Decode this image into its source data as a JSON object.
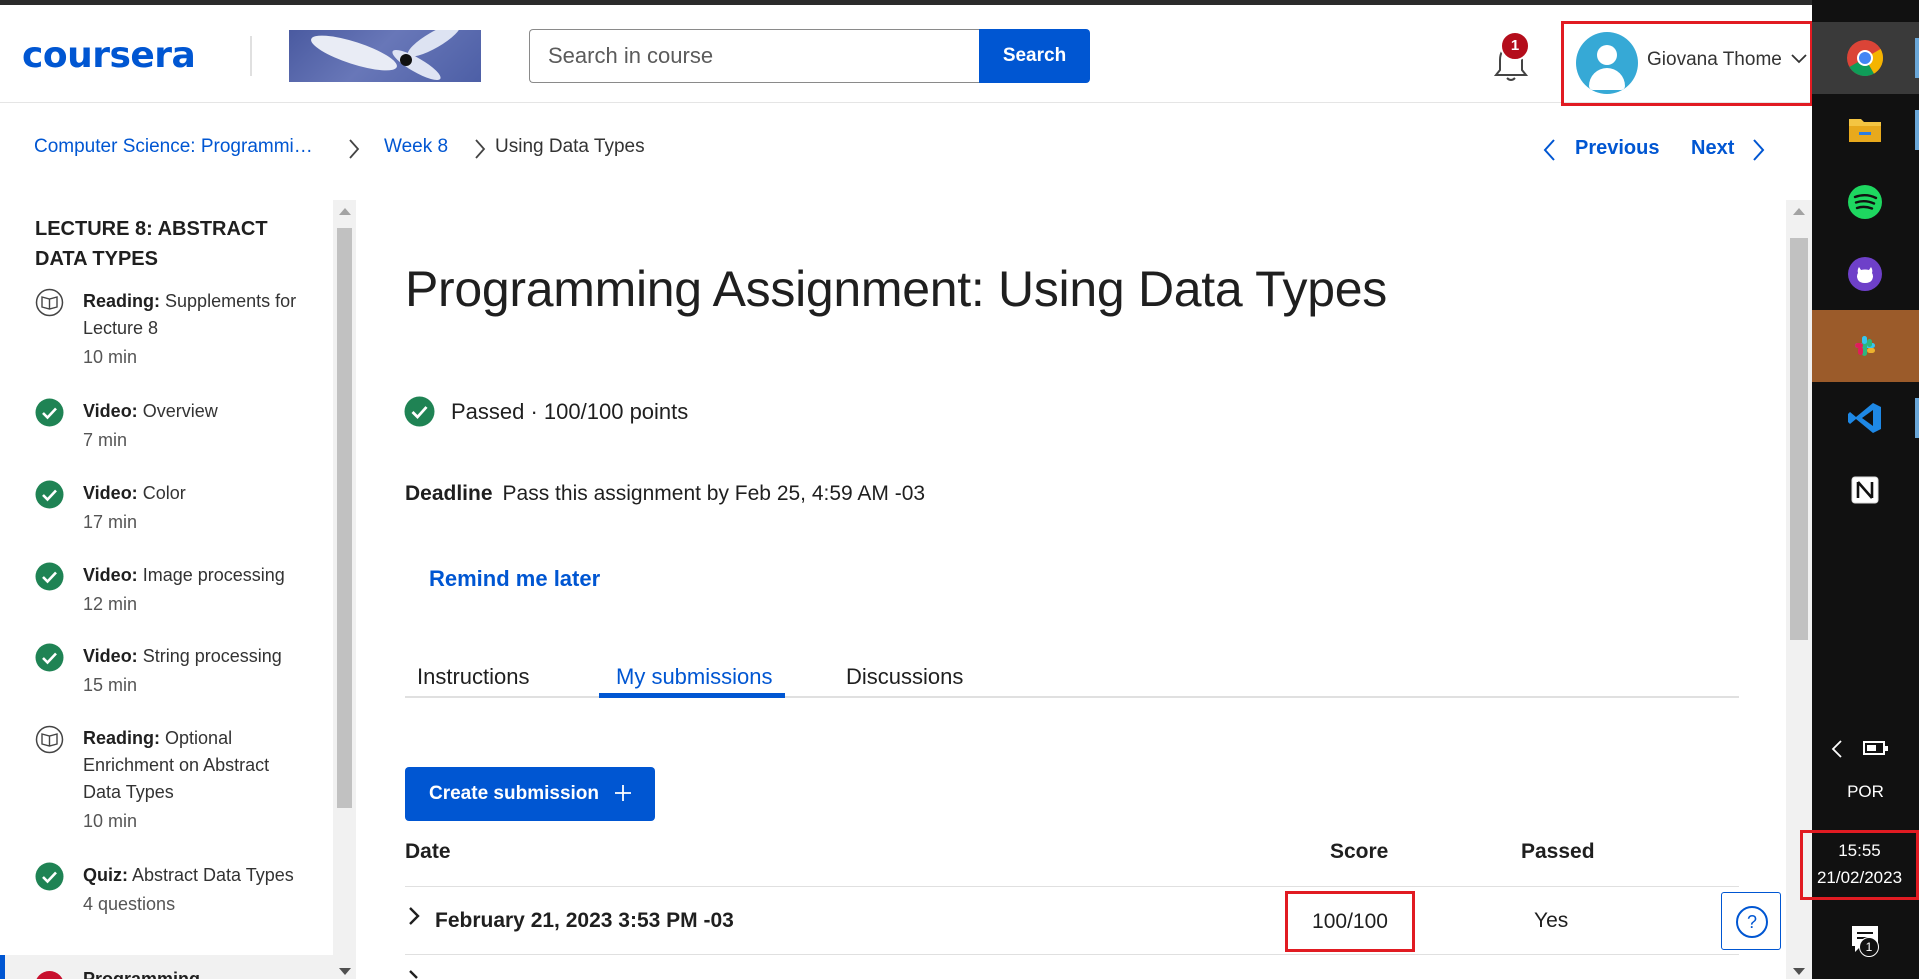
{
  "header": {
    "logo": "coursera",
    "search": {
      "placeholder": "Search in course",
      "button_label": "Search"
    },
    "notifications": {
      "count": "1"
    },
    "user": {
      "name": "Giovana Thome"
    }
  },
  "breadcrumb": {
    "items": [
      "Computer Science: Programmi…",
      "Week 8",
      "Using Data Types"
    ]
  },
  "navigation": {
    "previous": "Previous",
    "next": "Next"
  },
  "sidebar": {
    "title": "Lecture 8: Abstract Data Types",
    "items": [
      {
        "type": "Reading:",
        "title": "Supplements for Lecture 8",
        "meta": "10 min",
        "icon": "book-icon"
      },
      {
        "type": "Video:",
        "title": "Overview",
        "meta": "7 min",
        "icon": "check-circle-icon"
      },
      {
        "type": "Video:",
        "title": "Color",
        "meta": "17 min",
        "icon": "check-circle-icon"
      },
      {
        "type": "Video:",
        "title": "Image processing",
        "meta": "12 min",
        "icon": "check-circle-icon"
      },
      {
        "type": "Video:",
        "title": "String processing",
        "meta": "15 min",
        "icon": "check-circle-icon"
      },
      {
        "type": "Reading:",
        "title": "Optional Enrichment on Abstract Data Types",
        "meta": "10 min",
        "icon": "book-icon"
      },
      {
        "type": "Quiz:",
        "title": "Abstract Data Types",
        "meta": "4 questions",
        "icon": "check-circle-icon"
      }
    ],
    "current_item": "Programming"
  },
  "main": {
    "title": "Programming Assignment: Using Data Types",
    "status": "Passed · 100/100 points",
    "deadline": {
      "label": "Deadline",
      "text": "Pass this assignment by Feb 25, 4:59 AM -03"
    },
    "remind_label": "Remind me later",
    "tabs": [
      {
        "label": "Instructions",
        "active": false
      },
      {
        "label": "My submissions",
        "active": true
      },
      {
        "label": "Discussions",
        "active": false
      }
    ],
    "create_submission_label": "Create submission",
    "table": {
      "headers": {
        "date": "Date",
        "score": "Score",
        "passed": "Passed"
      },
      "rows": [
        {
          "date": "February 21, 2023 3:53 PM -03",
          "score": "100/100",
          "passed": "Yes"
        }
      ]
    },
    "help_label": "?"
  },
  "taskbar": {
    "apps": [
      "chrome-icon",
      "file-explorer-icon",
      "spotify-icon",
      "github-icon",
      "slack-icon",
      "vscode-icon",
      "notion-icon"
    ],
    "language": "POR",
    "time": "15:55",
    "date": "21/02/2023",
    "notification_count": "1"
  },
  "colors": {
    "brand": "#0056d2",
    "success": "#1f8354",
    "highlight_annotation": "#e11b22",
    "taskbar": "#111111"
  }
}
